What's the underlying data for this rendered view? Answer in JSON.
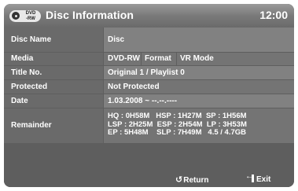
{
  "header": {
    "disc_type": "DVD\n-RW",
    "title": "Disc Information",
    "clock": "12:00"
  },
  "rows": {
    "disc_name": {
      "label": "Disc Name",
      "value": "Disc"
    },
    "media": {
      "label": "Media",
      "value": "DVD-RW",
      "format_label": "Format",
      "format_value": "VR Mode"
    },
    "title_no": {
      "label": "Title No.",
      "value": "Original 1 / Playlist 0"
    },
    "protected": {
      "label": "Protected",
      "value": "Not Protected"
    },
    "date": {
      "label": "Date",
      "value": "1.03.2008 ~ --.--.----"
    },
    "remainder": {
      "label": "Remainder",
      "line1": "HQ : 0H58M   HSP : 1H27M  SP : 1H56M",
      "line2": "LSP : 2H25M  ESP : 2H54M  LP : 3H53M",
      "line3": "EP : 5H48M    SLP : 7H49M   4.5 / 4.7GB"
    }
  },
  "footer": {
    "return_label": "Return",
    "exit_label": "Exit"
  }
}
